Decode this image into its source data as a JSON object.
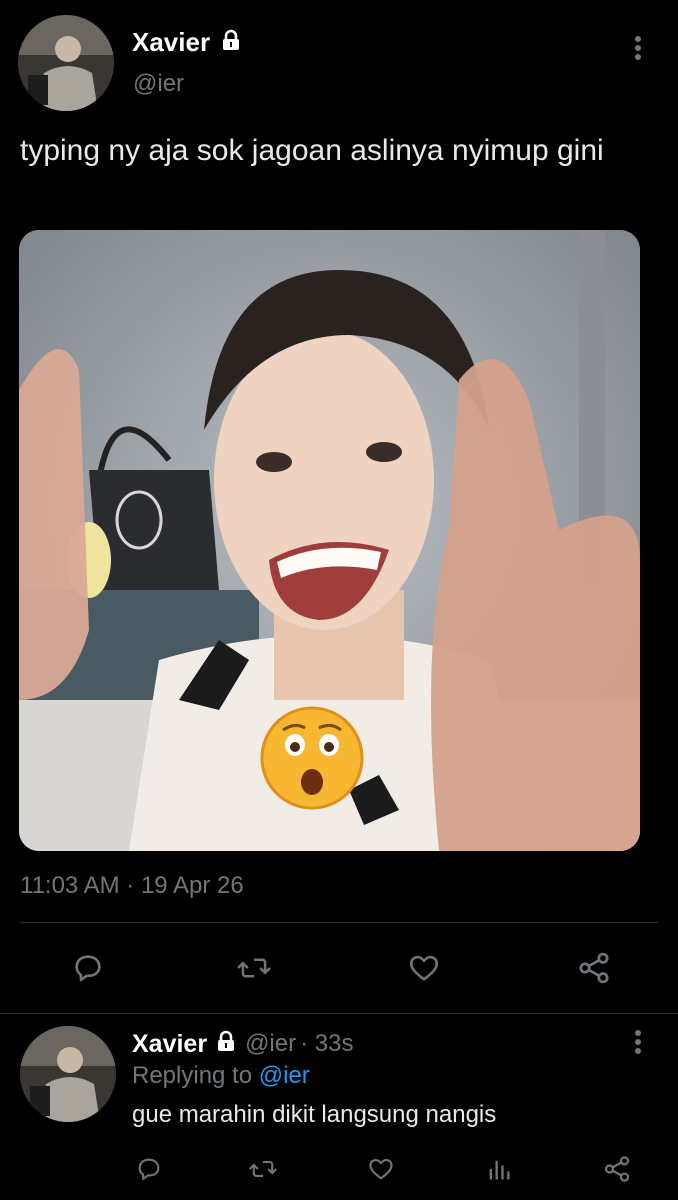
{
  "tweet": {
    "author": {
      "display_name": "Xavier",
      "handle": "@ier",
      "protected_icon": "lock-icon",
      "avatar": "profile-photo"
    },
    "text": "typing ny aja sok jagoan aslinya nyimup gini",
    "media": {
      "type": "photo",
      "description_icon": "hushed-face-emoji-sticker"
    },
    "timestamp": "11:03 AM · 19 Apr 26",
    "menu_icon": "more-vertical-icon",
    "actions": [
      "reply-icon",
      "retweet-icon",
      "like-icon",
      "share-icon"
    ]
  },
  "reply": {
    "author": {
      "display_name": "Xavier",
      "handle": "@ier",
      "time_ago": "· 33s",
      "protected_icon": "lock-icon"
    },
    "replying_prefix": "Replying to",
    "replying_to": "@ier",
    "text": "gue marahin dikit langsung nangis",
    "menu_icon": "more-vertical-icon",
    "actions": [
      "reply-icon",
      "retweet-icon",
      "like-icon",
      "analytics-icon",
      "share-icon"
    ]
  },
  "colors": {
    "background": "#000000",
    "text": "#e7e9ea",
    "muted": "#71767b",
    "link": "#1d9bf0",
    "divider": "#2f3336"
  }
}
